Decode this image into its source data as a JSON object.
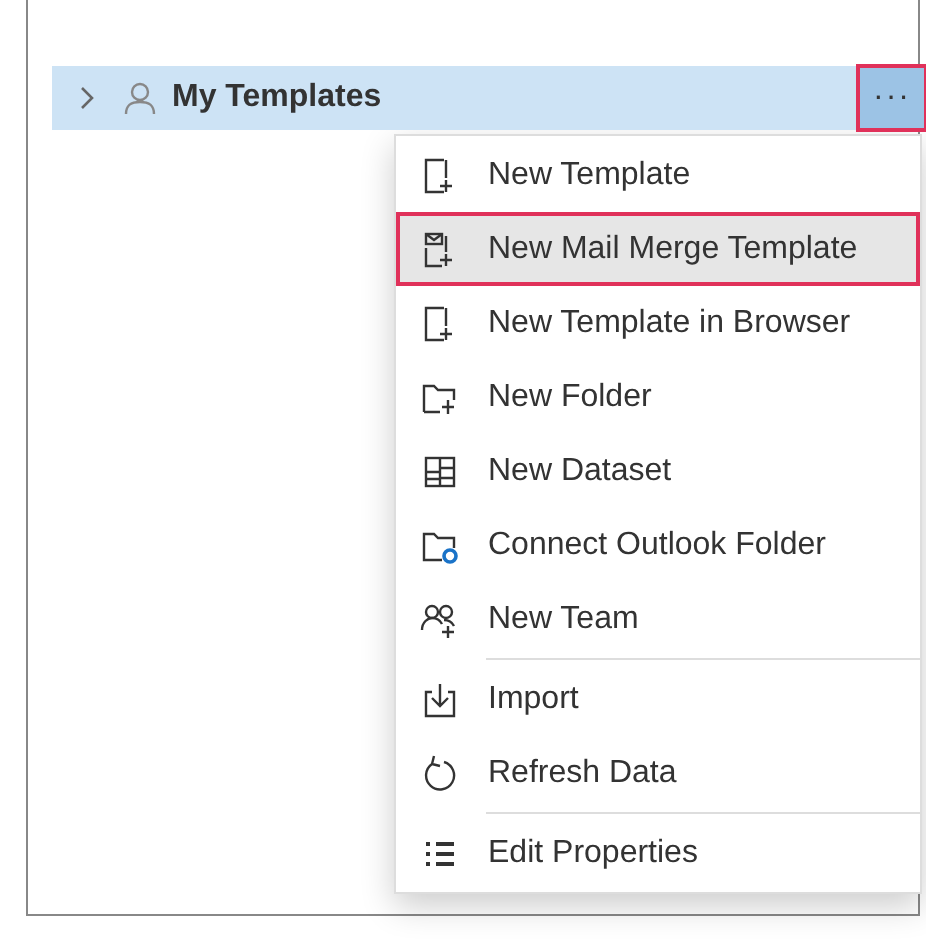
{
  "tree_item": {
    "label": "My Templates",
    "selected": true,
    "expanded": false
  },
  "more_button": {
    "label": "···",
    "highlighted": true
  },
  "menu": {
    "items": [
      {
        "kind": "item",
        "label": "New Template",
        "selected": false
      },
      {
        "kind": "item",
        "label": "New Mail Merge Template",
        "selected": true
      },
      {
        "kind": "item",
        "label": "New Template in Browser",
        "selected": false
      },
      {
        "kind": "item",
        "label": "New Folder",
        "selected": false
      },
      {
        "kind": "item",
        "label": "New Dataset",
        "selected": false
      },
      {
        "kind": "item",
        "label": "Connect Outlook Folder",
        "selected": false
      },
      {
        "kind": "item",
        "label": "New Team",
        "selected": false
      },
      {
        "kind": "divider"
      },
      {
        "kind": "item",
        "label": "Import",
        "selected": false
      },
      {
        "kind": "item",
        "label": "Refresh Data",
        "selected": false
      },
      {
        "kind": "divider"
      },
      {
        "kind": "item",
        "label": "Edit Properties",
        "selected": false
      }
    ]
  }
}
